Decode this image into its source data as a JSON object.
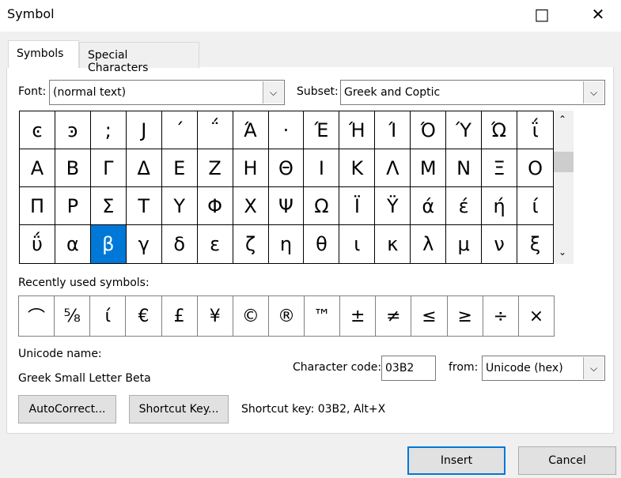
{
  "window": {
    "title": "Symbol",
    "maximize_icon": "□",
    "close_icon": "✕"
  },
  "tabs": [
    {
      "label": "Symbols",
      "active": true
    },
    {
      "label": "Special Characters",
      "active": false
    }
  ],
  "font": {
    "label": "Font:",
    "value": "(normal text)"
  },
  "subset": {
    "label": "Subset:",
    "value": "Greek and Coptic"
  },
  "symbols": [
    "ͼ",
    "ͽ",
    ";",
    "Ϳ",
    "΄",
    "΅",
    "Ά",
    "·",
    "Έ",
    "Ή",
    "Ί",
    "Ό",
    "Ύ",
    "Ώ",
    "ΐ",
    "Α",
    "Β",
    "Γ",
    "Δ",
    "Ε",
    "Ζ",
    "Η",
    "Θ",
    "Ι",
    "Κ",
    "Λ",
    "Μ",
    "Ν",
    "Ξ",
    "Ο",
    "Π",
    "Ρ",
    "Σ",
    "Τ",
    "Υ",
    "Φ",
    "Χ",
    "Ψ",
    "Ω",
    "Ϊ",
    "Ϋ",
    "ά",
    "έ",
    "ή",
    "ί",
    "ΰ",
    "α",
    "β",
    "γ",
    "δ",
    "ε",
    "ζ",
    "η",
    "θ",
    "ι",
    "κ",
    "λ",
    "μ",
    "ν",
    "ξ"
  ],
  "selected_symbol": "β",
  "accent_color": "#0078d7",
  "recent": {
    "label": "Recently used symbols:",
    "items": [
      "⌒",
      "⅝",
      "ί",
      "€",
      "£",
      "¥",
      "©",
      "®",
      "™",
      "±",
      "≠",
      "≤",
      "≥",
      "÷",
      "×"
    ]
  },
  "unicode_name": {
    "label": "Unicode name:",
    "value": "Greek Small Letter Beta"
  },
  "char_code": {
    "label": "Character code:",
    "value": "03B2"
  },
  "from": {
    "label": "from:",
    "value": "Unicode (hex)"
  },
  "buttons": {
    "autocorrect": "AutoCorrect...",
    "shortcut_key": "Shortcut Key...",
    "insert": "Insert",
    "cancel": "Cancel"
  },
  "shortcut_text": "Shortcut key: 03B2, Alt+X"
}
